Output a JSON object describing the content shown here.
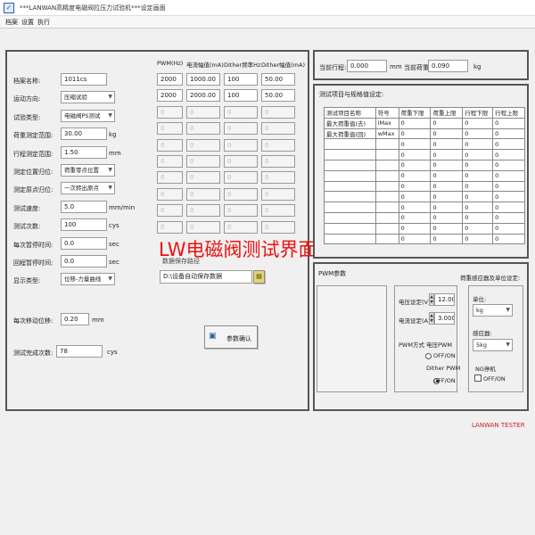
{
  "window": {
    "title": "***LANWAN高精度电磁阀拉压力试验机***设定画面"
  },
  "menu": [
    "档案",
    "设置",
    "执行"
  ],
  "left_params": [
    {
      "label": "档案名称:",
      "value": "1011cs",
      "kind": "field"
    },
    {
      "label": "运动方向:",
      "value": "压缩试验",
      "kind": "combo"
    },
    {
      "label": "试验类型:",
      "value": "电磁阀PS测试",
      "kind": "combo"
    },
    {
      "label": "荷重测定范围:",
      "value": "30.00",
      "unit": "kg",
      "kind": "field"
    },
    {
      "label": "行程测定范围:",
      "value": "1.50",
      "unit": "mm",
      "kind": "field"
    },
    {
      "label": "测定位置归位:",
      "value": "荷重零点位置",
      "kind": "combo"
    },
    {
      "label": "测定原点归位:",
      "value": "一次转出原点",
      "kind": "combo"
    },
    {
      "label": "测试速度:",
      "value": "5.0",
      "unit": "mm/min",
      "kind": "field"
    },
    {
      "label": "测试次数:",
      "value": "100",
      "unit": "cys",
      "kind": "field"
    },
    {
      "label": "每次暂停时间:",
      "value": "0.0",
      "unit": "sec",
      "kind": "field"
    },
    {
      "label": "回程暂停时间:",
      "value": "0.0",
      "unit": "sec",
      "kind": "field"
    },
    {
      "label": "显示类型:",
      "value": "位移-力量曲线",
      "kind": "combo"
    }
  ],
  "step_interval": {
    "label": "每次移动位移:",
    "value": "0.20",
    "unit": "mm"
  },
  "completed": {
    "label": "测试完成次数:",
    "value": "78",
    "unit": "cys"
  },
  "pwm_table": {
    "headers": [
      "PWM(Hz)",
      "电流幅值(mA)",
      "Dither频率Hz",
      "Dither幅值(mA)"
    ],
    "rows": [
      [
        "2000",
        "1000.00",
        "100",
        "50.00"
      ],
      [
        "2000",
        "2000.00",
        "100",
        "50.00"
      ],
      [
        "0",
        "0",
        "0",
        "0"
      ],
      [
        "0",
        "0",
        "0",
        "0"
      ],
      [
        "0",
        "0",
        "0",
        "0"
      ],
      [
        "0",
        "0",
        "0",
        "0"
      ],
      [
        "0",
        "0",
        "0",
        "0"
      ],
      [
        "0",
        "0",
        "0",
        "0"
      ],
      [
        "0",
        "0",
        "0",
        "0"
      ],
      [
        "0",
        "0",
        "0",
        "0"
      ]
    ]
  },
  "file_save": {
    "label": "数据保存路径",
    "value": "D:\\设备自动保存数据"
  },
  "confirm_button": "参数确认",
  "overlay_text": "LW电磁阀测试界面",
  "status": {
    "stroke_label": "当前行程:",
    "stroke_value": "0.000",
    "stroke_unit": "mm",
    "load_label": "当前荷重:",
    "load_value": "0.090",
    "load_unit": "kg"
  },
  "test_items": {
    "title": "测试项目与规格值设定:",
    "headers": [
      "测试项目名称",
      "符号",
      "荷重下限",
      "荷重上限",
      "行程下限",
      "行程上限"
    ],
    "rows": [
      [
        "最大荷重值(去)",
        "iMax",
        "0",
        "0",
        "0",
        "0"
      ],
      [
        "最大荷重值(回)",
        "wMax",
        "0",
        "0",
        "0",
        "0"
      ],
      [
        "",
        "",
        "0",
        "0",
        "0",
        "0"
      ],
      [
        "",
        "",
        "0",
        "0",
        "0",
        "0"
      ],
      [
        "",
        "",
        "0",
        "0",
        "0",
        "0"
      ],
      [
        "",
        "",
        "0",
        "0",
        "0",
        "0"
      ],
      [
        "",
        "",
        "0",
        "0",
        "0",
        "0"
      ],
      [
        "",
        "",
        "0",
        "0",
        "0",
        "0"
      ],
      [
        "",
        "",
        "0",
        "0",
        "0",
        "0"
      ],
      [
        "",
        "",
        "0",
        "0",
        "0",
        "0"
      ],
      [
        "",
        "",
        "0",
        "0",
        "0",
        "0"
      ],
      [
        "",
        "",
        "0",
        "0",
        "0",
        "0"
      ]
    ]
  },
  "pwm_params": {
    "title": "PWM参数",
    "voltage_label": "电压设定(V)",
    "voltage_value": "12.000",
    "current_label": "电流设定(A)",
    "current_value": "3.000",
    "mode_label": "PWM方式",
    "voltage_pwm_label": "电压PWM",
    "voltage_pwm_state": "OFF/ON",
    "dither_label": "Dither PWM",
    "dither_state": "OFF/ON"
  },
  "load_setting": {
    "title": "荷重感应器及单位设定:",
    "unit_label": "单位:",
    "unit_value": "kg",
    "sensor_label": "感应器:",
    "sensor_value": "5kg",
    "ng_label": "NG停机",
    "ng_state": "OFF/ON"
  },
  "brand": "LANWAN TESTER",
  "colors": {
    "overlay": "#ee1111",
    "brand": "#cc2222"
  }
}
